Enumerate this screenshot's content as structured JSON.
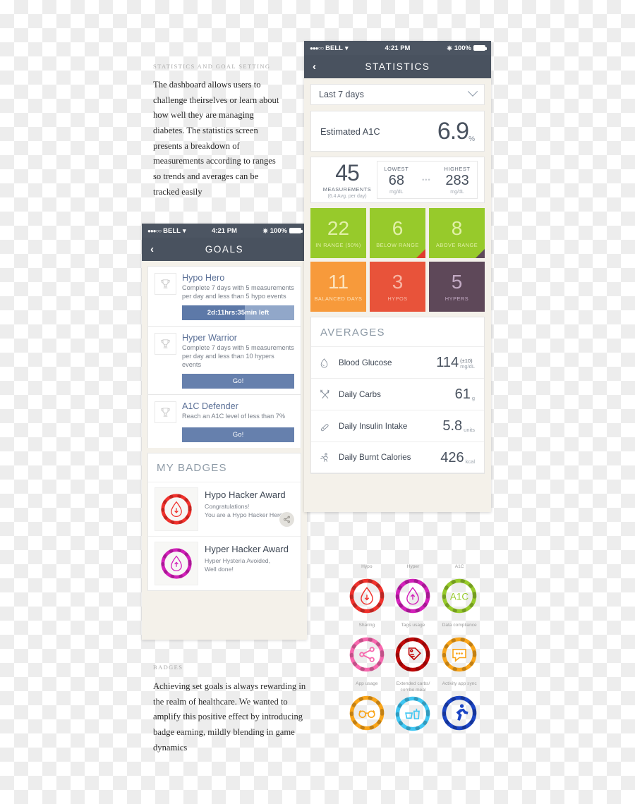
{
  "annotations": {
    "top": {
      "kicker": "STATISTICS AND GOAL SETTING",
      "body": "The dashboard allows users to challenge theirselves or learn about how well they are managing diabetes. The statistics screen presents a breakdown of measurements according to ranges so trends and averages can be tracked easily"
    },
    "bottom": {
      "kicker": "BADGES",
      "body": "Achieving set goals is always rewarding in the realm of healthcare. We wanted to amplify this positive effect by introducing badge earning, mildly blending in game dynamics"
    }
  },
  "statistics_phone": {
    "statusbar": {
      "carrier": "BELL",
      "time": "4:21 PM",
      "battery": "100%",
      "dots": "●●●○○",
      "wifi_icon": "wifi-icon",
      "bluetooth_icon": "bluetooth-icon"
    },
    "navbar": {
      "back_icon": "‹",
      "title": "STATISTICS"
    },
    "range_selector": {
      "value": "Last 7 days",
      "chevron_icon": "chevron-down-icon"
    },
    "a1c": {
      "label": "Estimated A1C",
      "value": "6.9",
      "unit": "%"
    },
    "measurements": {
      "count": "45",
      "caption": "MEASUREMENTS",
      "subcaption": "(6.4 Avg. per day)",
      "lowest_label": "LOWEST",
      "lowest_value": "68",
      "lowest_unit": "mg/dL",
      "separator": "•••",
      "highest_label": "HIGHEST",
      "highest_value": "283",
      "highest_unit": "mg/dL"
    },
    "tiles": [
      {
        "value": "22",
        "label": "IN RANGE (50%)",
        "bg": "#97ca2b",
        "fg": "#e2f0a8",
        "corner": ""
      },
      {
        "value": "6",
        "label": "BELOW RANGE",
        "bg": "#97ca2b",
        "fg": "#e2f0a8",
        "corner": "#e03b2f"
      },
      {
        "value": "8",
        "label": "ABOVE RANGE",
        "bg": "#97ca2b",
        "fg": "#e2f0a8",
        "corner": "#5e4859"
      },
      {
        "value": "11",
        "label": "BALANCED DAYS",
        "bg": "#f79a3b",
        "fg": "#fde3bc",
        "corner": ""
      },
      {
        "value": "3",
        "label": "HYPOS",
        "bg": "#e8533a",
        "fg": "#f7b5a4",
        "corner": ""
      },
      {
        "value": "5",
        "label": "HYPERS",
        "bg": "#5e4859",
        "fg": "#c3aac4",
        "corner": ""
      }
    ],
    "averages": {
      "heading": "AVERAGES",
      "rows": [
        {
          "icon": "droplet-icon",
          "name": "Blood Glucose",
          "value": "114",
          "delta": "(±10)",
          "unit": "mg/dL"
        },
        {
          "icon": "cutlery-icon",
          "name": "Daily Carbs",
          "value": "61",
          "delta": "",
          "unit": "g"
        },
        {
          "icon": "pen-icon",
          "name": "Daily Insulin Intake",
          "value": "5.8",
          "delta": "",
          "unit": "units"
        },
        {
          "icon": "runner-icon",
          "name": "Daily Burnt Calories",
          "value": "426",
          "delta": "",
          "unit": "kcal"
        }
      ]
    }
  },
  "goals_phone": {
    "statusbar": {
      "carrier": "BELL",
      "time": "4:21 PM",
      "battery": "100%",
      "dots": "●●●○○"
    },
    "navbar": {
      "back_icon": "‹",
      "title": "GOALS"
    },
    "goals": [
      {
        "title": "Hypo Hero",
        "description": "Complete 7 days with 5 measurements per day and less than 5 hypo events",
        "action_type": "progress",
        "progress_label": "2d:11hrs:35min left",
        "progress_percent": 56
      },
      {
        "title": "Hyper Warrior",
        "description": "Complete 7 days with 5 measurements per day and less than 10 hypers events",
        "action_type": "button",
        "button_label": "Go!"
      },
      {
        "title": "A1C Defender",
        "description": "Reach an A1C level of less than 7%",
        "action_type": "button",
        "button_label": "Go!"
      }
    ],
    "badges_panel": {
      "heading": "MY BADGES",
      "items": [
        {
          "title": "Hypo Hacker Award",
          "description": "Congratulations!\nYou are a Hypo Hacker Hero!",
          "ring_color": "#f0322d",
          "icon": "droplet-down-icon",
          "has_share": true,
          "share_icon": "share-icon"
        },
        {
          "title": "Hyper Hacker Award",
          "description": "Hyper Hysteria Avoided,\nWell done!",
          "ring_color": "#d321ba",
          "icon": "droplet-up-icon",
          "has_share": false
        }
      ]
    }
  },
  "badge_sheet": [
    {
      "label": "Hypo",
      "color": "#f0322d",
      "icon": "droplet-down-icon"
    },
    {
      "label": "Hyper",
      "color": "#d321ba",
      "icon": "droplet-up-icon"
    },
    {
      "label": "A1C",
      "color": "#97ca2b",
      "icon": "a1c-text-icon",
      "icon_text": "A1C"
    },
    {
      "label": "Sharing",
      "color": "#f768ae",
      "icon": "share-icon"
    },
    {
      "label": "Tags usage",
      "color": "#c00808",
      "icon": "tag-icon"
    },
    {
      "label": "Data compliance",
      "color": "#f9a51a",
      "icon": "speech-bubble-icon"
    },
    {
      "label": "App usage",
      "color": "#f9a51a",
      "icon": "glasses-icon"
    },
    {
      "label": "Extended carbs/ combo meal",
      "color": "#3fc6f2",
      "icon": "meal-icon"
    },
    {
      "label": "Activity app sync",
      "color": "#1b45c4",
      "icon": "runner-icon"
    }
  ]
}
